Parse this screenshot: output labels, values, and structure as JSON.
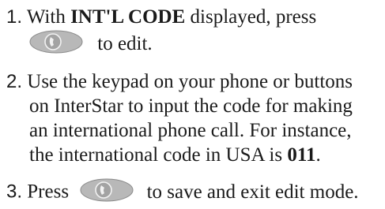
{
  "steps": [
    {
      "number": "1.",
      "line1_before": "With ",
      "line1_bold": "INT'L CODE",
      "line1_after": " displayed, press",
      "line2_after": "to edit."
    },
    {
      "number": "2.",
      "line1_text": "Use the keypad on your phone or buttons",
      "line2_text": "on InterStar to input the code for making",
      "line3_text": "an international phone call.  For instance,",
      "line4_before": "the international code in USA is ",
      "line4_bold": "011",
      "line4_after": "."
    },
    {
      "number": "3.",
      "before": "Press",
      "after": "to save and exit edit mode."
    }
  ],
  "icons": {
    "button": "phone-button-icon"
  },
  "colors": {
    "text": "#1a1a1a",
    "button_fill": "#b8b8b8",
    "button_inner": "#9a9a9a"
  }
}
